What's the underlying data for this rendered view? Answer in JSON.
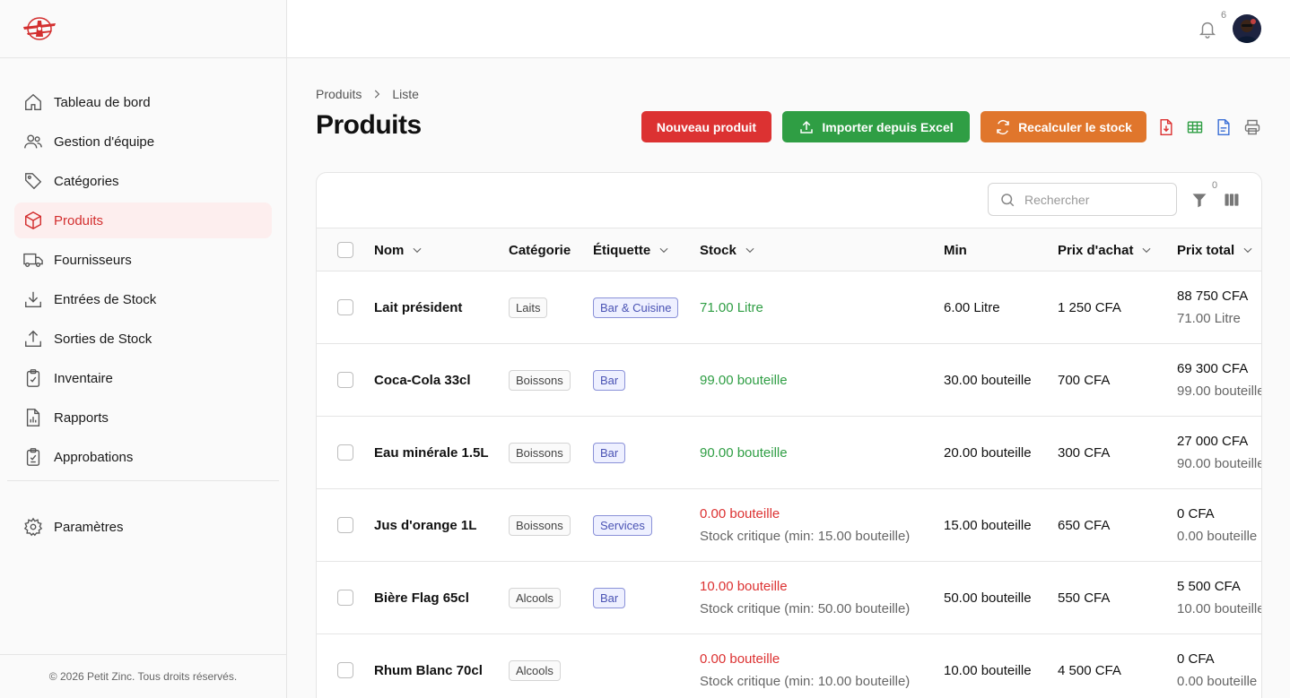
{
  "sidebar": {
    "items": [
      {
        "label": "Tableau de bord",
        "icon": "home-icon"
      },
      {
        "label": "Gestion d'équipe",
        "icon": "users-icon"
      },
      {
        "label": "Catégories",
        "icon": "tag-icon"
      },
      {
        "label": "Produits",
        "icon": "box-icon",
        "active": true
      },
      {
        "label": "Fournisseurs",
        "icon": "truck-icon"
      },
      {
        "label": "Entrées de Stock",
        "icon": "download-icon"
      },
      {
        "label": "Sorties de Stock",
        "icon": "upload-icon"
      },
      {
        "label": "Inventaire",
        "icon": "clipboard-check-icon"
      },
      {
        "label": "Rapports",
        "icon": "report-icon"
      },
      {
        "label": "Approbations",
        "icon": "clipboard-approve-icon"
      }
    ],
    "settings": {
      "label": "Paramètres",
      "icon": "gear-icon"
    },
    "footer": "© 2026 Petit Zinc. Tous droits réservés."
  },
  "header": {
    "notification_count": "6"
  },
  "breadcrumb": {
    "parent": "Produits",
    "current": "Liste"
  },
  "page": {
    "title": "Produits"
  },
  "actions": {
    "new_product": "Nouveau produit",
    "import_excel": "Importer depuis Excel",
    "recalc_stock": "Recalculer le stock"
  },
  "toolbar": {
    "search_placeholder": "Rechercher",
    "filter_count": "0"
  },
  "table": {
    "columns": {
      "name": "Nom",
      "category": "Catégorie",
      "label": "Étiquette",
      "stock": "Stock",
      "min": "Min",
      "purchase_price": "Prix d'achat",
      "total_price": "Prix total"
    },
    "rows": [
      {
        "name": "Lait président",
        "category": "Laits",
        "label": "Bar & Cuisine",
        "stock": "71.00 Litre",
        "stock_note": "",
        "status": "ok",
        "min": "6.00 Litre",
        "purchase": "1 250 CFA",
        "total": "88 750 CFA",
        "total_sub": "71.00 Litre"
      },
      {
        "name": "Coca-Cola 33cl",
        "category": "Boissons",
        "label": "Bar",
        "stock": "99.00 bouteille",
        "stock_note": "",
        "status": "ok",
        "min": "30.00 bouteille",
        "purchase": "700 CFA",
        "total": "69 300 CFA",
        "total_sub": "99.00 bouteille"
      },
      {
        "name": "Eau minérale 1.5L",
        "category": "Boissons",
        "label": "Bar",
        "stock": "90.00 bouteille",
        "stock_note": "",
        "status": "ok",
        "min": "20.00 bouteille",
        "purchase": "300 CFA",
        "total": "27 000 CFA",
        "total_sub": "90.00 bouteille"
      },
      {
        "name": "Jus d'orange 1L",
        "category": "Boissons",
        "label": "Services",
        "stock": "0.00 bouteille",
        "stock_note": "Stock critique (min: 15.00 bouteille)",
        "status": "critical",
        "min": "15.00 bouteille",
        "purchase": "650 CFA",
        "total": "0 CFA",
        "total_sub": "0.00 bouteille"
      },
      {
        "name": "Bière Flag 65cl",
        "category": "Alcools",
        "label": "Bar",
        "stock": "10.00 bouteille",
        "stock_note": "Stock critique (min: 50.00 bouteille)",
        "status": "critical",
        "min": "50.00 bouteille",
        "purchase": "550 CFA",
        "total": "5 500 CFA",
        "total_sub": "10.00 bouteille"
      },
      {
        "name": "Rhum Blanc 70cl",
        "category": "Alcools",
        "label": "",
        "stock": "0.00 bouteille",
        "stock_note": "Stock critique (min: 10.00 bouteille)",
        "status": "critical",
        "min": "10.00 bouteille",
        "purchase": "4 500 CFA",
        "total": "0 CFA",
        "total_sub": "0.00 bouteille"
      }
    ]
  },
  "colors": {
    "accent": "#dc3232",
    "success": "#2f9e44",
    "warning": "#e0762c",
    "label": "#4a53b4"
  }
}
